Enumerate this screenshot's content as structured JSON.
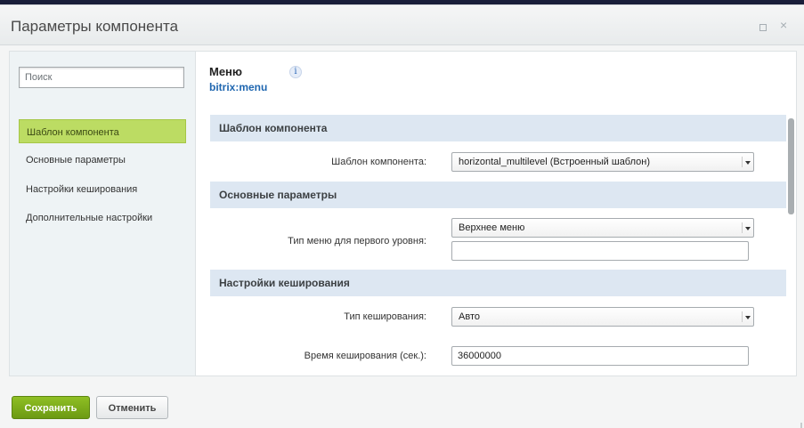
{
  "window": {
    "title": "Параметры компонента",
    "controls": [
      "maximize-icon",
      "close-icon"
    ]
  },
  "sidebar": {
    "search_placeholder": "Поиск",
    "items": [
      {
        "label": "Шаблон компонента",
        "active": true
      },
      {
        "label": "Основные параметры",
        "active": false
      },
      {
        "label": "Настройки кеширования",
        "active": false
      },
      {
        "label": "Дополнительные настройки",
        "active": false
      }
    ]
  },
  "component": {
    "name": "Меню",
    "code": "bitrix:menu",
    "info_icon": "info-icon"
  },
  "sections": [
    {
      "title": "Шаблон компонента",
      "fields": [
        {
          "label": "Шаблон компонента:",
          "type": "select",
          "value": "horizontal_multilevel (Встроенный шаблон)"
        }
      ]
    },
    {
      "title": "Основные параметры",
      "fields": [
        {
          "label": "Тип меню для первого уровня:",
          "type": "select",
          "value": "Верхнее меню",
          "extra_input_value": ""
        }
      ]
    },
    {
      "title": "Настройки кеширования",
      "fields": [
        {
          "label": "Тип кеширования:",
          "type": "select",
          "value": "Авто"
        },
        {
          "label": "Время кеширования (сек.):",
          "type": "text",
          "value": "36000000"
        }
      ]
    }
  ],
  "footer": {
    "save_label": "Сохранить",
    "cancel_label": "Отменить"
  },
  "colors": {
    "accent_green": "#6c9a13",
    "active_item": "#bcdc63",
    "section_header": "#dde7f2",
    "link_blue": "#2067b0"
  }
}
